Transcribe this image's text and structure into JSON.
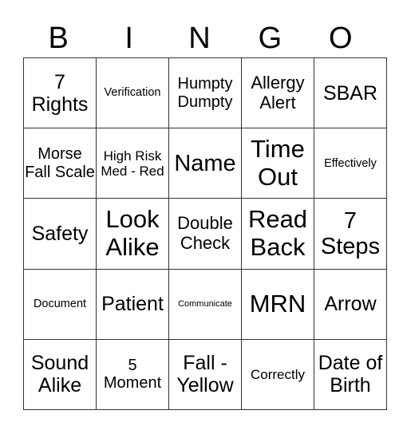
{
  "header": [
    "B",
    "I",
    "N",
    "G",
    "O"
  ],
  "rows": [
    [
      "7 Rights",
      "Verification",
      "Humpty Dumpty",
      "Allergy Alert",
      "SBAR"
    ],
    [
      "Morse Fall Scale",
      "High Risk Med - Red",
      "Name",
      "Time Out",
      "Effectively"
    ],
    [
      "Safety",
      "Look Alike",
      "Double Check",
      "Read Back",
      "7 Steps"
    ],
    [
      "Document",
      "Patient",
      "Communicate",
      "MRN",
      "Arrow"
    ],
    [
      "Sound Alike",
      "5 Moment",
      "Fall - Yellow",
      "Correctly",
      "Date of Birth"
    ]
  ]
}
